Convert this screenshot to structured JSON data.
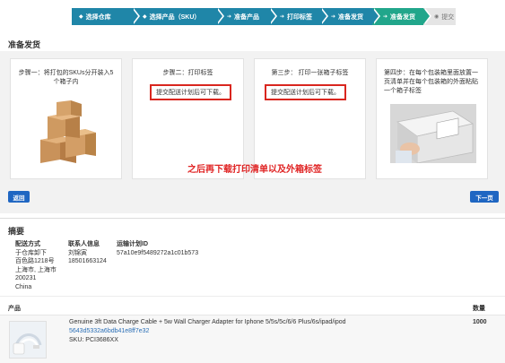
{
  "stepper": [
    {
      "label": "选择仓库",
      "icon": "tag-icon",
      "state": "done"
    },
    {
      "label": "选择产品（SKU）",
      "icon": "tag-icon",
      "state": "done"
    },
    {
      "label": "准备产品",
      "icon": "arrow-icon",
      "state": "done"
    },
    {
      "label": "打印标签",
      "icon": "arrow-icon",
      "state": "done"
    },
    {
      "label": "准备发货",
      "icon": "arrow-icon",
      "state": "done"
    },
    {
      "label": "准备发货",
      "icon": "arrow-icon",
      "state": "active"
    },
    {
      "label": "提交",
      "icon": "check-circle-icon",
      "state": "todo"
    }
  ],
  "page_title": "准备发货",
  "cards": [
    {
      "title": "步骤一：将打包的SKUs分开装入5个箱子内",
      "note": "",
      "image": "stacked-boxes"
    },
    {
      "title": "步骤二：打印标签",
      "note": "提交配送计划后可下载。",
      "image": ""
    },
    {
      "title": "第三步：  打印一张箱子标签",
      "note": "提交配送计划后可下载。",
      "image": ""
    },
    {
      "title": "第四步：在每个包装箱里面放置一页清单并在每个包装箱的外面粘贴一个箱子标签",
      "note": "",
      "image": "box-with-label"
    }
  ],
  "annotation": "之后再下载打印清单以及外箱标签",
  "buttons": {
    "back": "返回",
    "next": "下一页"
  },
  "summary": {
    "title": "摘要",
    "shipping_method": {
      "label": "配送方式",
      "lines": [
        "于仓库卸下",
        "百色路1218号",
        "上海市, 上海市",
        "200231",
        "China"
      ]
    },
    "contact": {
      "label": "联系人信息",
      "lines": [
        "刘锦寅",
        "18501663124"
      ]
    },
    "plan_id": {
      "label": "运输计划ID",
      "value": "57a10e9f5489272a1c01b573"
    }
  },
  "table": {
    "headers": {
      "product": "产品",
      "quantity": "数量"
    },
    "rows": [
      {
        "name": "Genuine 3ft Data Charge Cable + 5w Wall Charger Adapter for Iphone 5/5s/5c/6/6 Plus/6s/ipad/ipod",
        "id": "5643d5332a6bdb41e8ff7e32",
        "sku": "SKU: PCI3686XX",
        "quantity": "1000"
      }
    ]
  },
  "colors": {
    "done": "#1f86a8",
    "active": "#21a68b",
    "todo": "#e5e5e5",
    "primary_button": "#1f66c2",
    "highlight": "#d9261f"
  }
}
